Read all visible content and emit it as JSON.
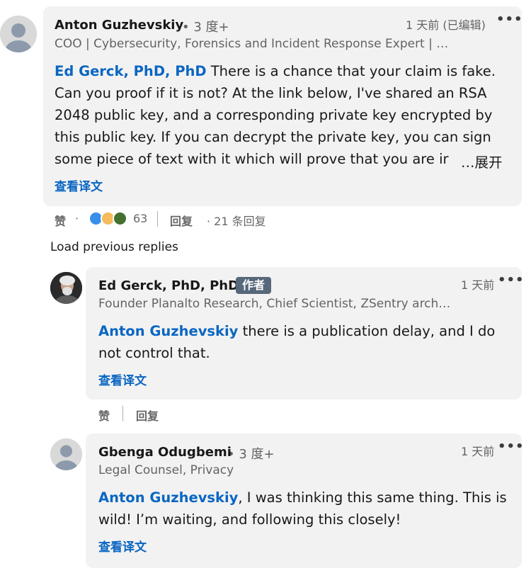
{
  "comment": {
    "author": "Anton Guzhevskiy",
    "degree": "• 3 度+",
    "headline": "COO | Cybersecurity, Forensics and Incident Response Expert | …",
    "time": "1 天前 (已编辑)",
    "more": "•••",
    "mention": "Ed Gerck, PhD, PhD",
    "lines": [
      " There is a chance that your claim is fake.",
      "Can you proof if it is not? At the link below, I've shared an RSA",
      "2048 public key, and a corresponding private key encrypted by",
      "this public key. If you can decrypt the private key, you can sign",
      "some piece of text with it which will prove that you are ir"
    ],
    "expand": "…展开",
    "translate": "查看译文",
    "like": "赞",
    "dot": "·",
    "reaction_count": "63",
    "reply": "回复",
    "reply_count": "· 21 条回复"
  },
  "load_previous": "Load previous replies",
  "reply1": {
    "author": "Ed Gerck, PhD, PhD",
    "badge": "作者",
    "headline": "Founder Planalto Research, Chief Scientist, ZSentry arch…",
    "time": "1 天前",
    "more": "•••",
    "mention": "Anton Guzhevskiy",
    "line1": " there is a publication delay, and I do",
    "line2": "not control that.",
    "translate": "查看译文",
    "like": "赞",
    "reply": "回复"
  },
  "reply2": {
    "author": "Gbenga Odugbemi",
    "degree": "• 3 度+",
    "headline": "Legal Counsel, Privacy",
    "time": "1 天前",
    "more": "•••",
    "mention": "Anton Guzhevskiy",
    "line1": ", I was thinking this same thing. This is",
    "line2": "wild! I’m waiting, and following this closely!",
    "translate": "查看译文"
  },
  "colors": {
    "link": "#0a66c2",
    "card": "#f2f2f2",
    "badge": "#56687a"
  }
}
